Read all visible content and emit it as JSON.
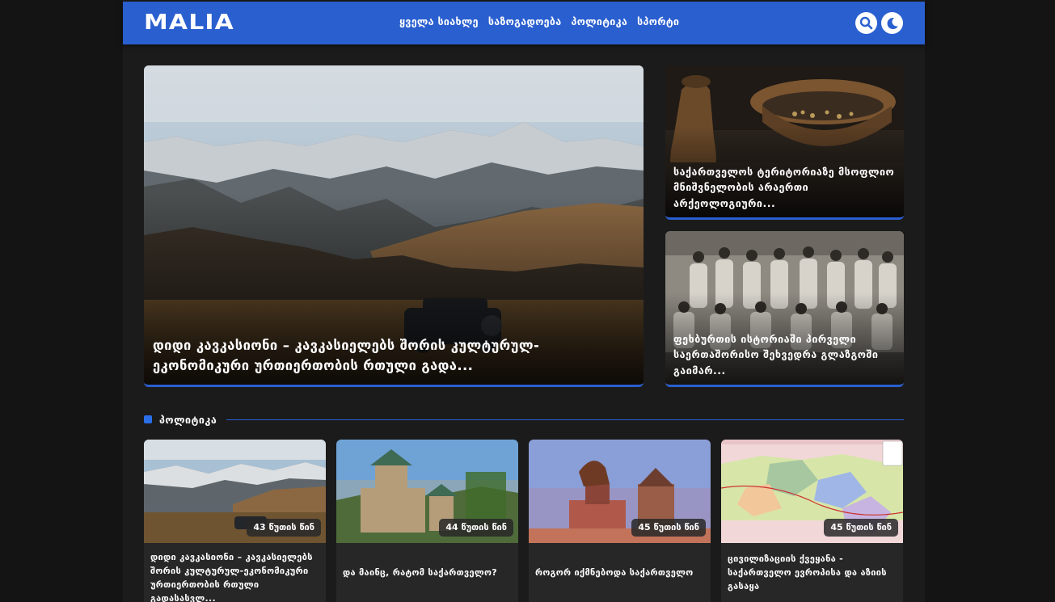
{
  "header": {
    "logo": "MALIA",
    "nav": [
      "ყველა სიახლე",
      "საზოგადოება",
      "პოლიტიკა",
      "სპორტი"
    ],
    "search_icon": "search-icon",
    "theme_icon": "moon-icon",
    "accent": "#2a5fcf"
  },
  "hero": {
    "main_title": "დიდი კავკასიონი – კავკასიელებს შორის კულტურულ-ეკონომიკური ურთიერთობის რთული გადა...",
    "side1_title": "საქართველოს ტერიტორიაზე მსოფლიო მნიშვნელობის არაერთი არქეოლოგიური...",
    "side2_title": "ფეხბურთის ისტორიაში პირველი საერთაშორისო შეხვედრა გლაზგოში გაიმარ..."
  },
  "section": {
    "label": "პოლიტიკა"
  },
  "cards": [
    {
      "time": "43 წუთის წინ",
      "title": "დიდი კავკასიონი – კავკასიელებს შორის კულტურულ-ეკონომიკური ურთიერთობის რთული გადასასვლ..."
    },
    {
      "time": "44 წუთის წინ",
      "title": "და მაინც, რატომ საქართველო?"
    },
    {
      "time": "45 წუთის წინ",
      "title": "როგორ იქმნებოდა საქართველო"
    },
    {
      "time": "45 წუთის წინ",
      "title": "ცივილიზაციის ქვეყანა - საქართველო ევროპისა და აზიის გასაყა"
    }
  ]
}
